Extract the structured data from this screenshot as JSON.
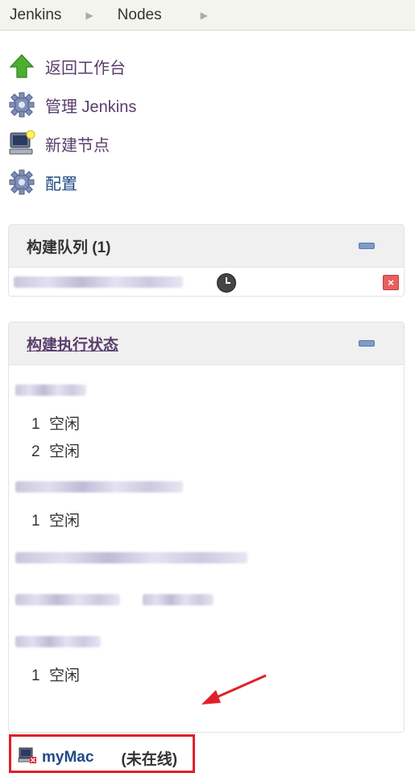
{
  "breadcrumb": {
    "items": [
      "Jenkins",
      "Nodes"
    ]
  },
  "tasks": [
    {
      "label": "返回工作台",
      "icon": "up-arrow-icon"
    },
    {
      "label": "管理 Jenkins",
      "icon": "gear-icon"
    },
    {
      "label": "新建节点",
      "icon": "computer-new-icon"
    },
    {
      "label": "配置",
      "icon": "gear-icon"
    }
  ],
  "queue": {
    "title": "构建队列 (1)"
  },
  "executors": {
    "title": "构建执行状态",
    "groups": [
      {
        "executors": [
          {
            "num": "1",
            "state": "空闲"
          },
          {
            "num": "2",
            "state": "空闲"
          }
        ]
      },
      {
        "executors": [
          {
            "num": "1",
            "state": "空闲"
          }
        ]
      },
      {
        "executors": []
      },
      {
        "executors": []
      },
      {
        "executors": [
          {
            "num": "1",
            "state": "空闲"
          }
        ]
      }
    ],
    "offline_node": {
      "name": "myMac",
      "status": "(未在线)"
    }
  },
  "colors": {
    "link_purple": "#5a3d6b",
    "link_blue": "#204a87",
    "highlight_red": "#e0202a"
  }
}
